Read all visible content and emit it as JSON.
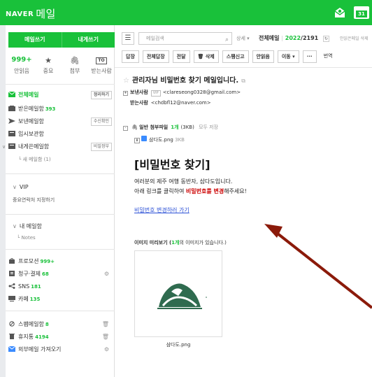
{
  "header": {
    "brand": "NAVER",
    "app_name": "메일",
    "calendar_num": "31"
  },
  "sidebar": {
    "write_mail": "메일쓰기",
    "write_to_me": "내게쓰기",
    "quick": [
      {
        "value": "999+",
        "label": "안읽음"
      },
      {
        "value": "★",
        "label": "중요"
      },
      {
        "value": "🖇",
        "label": "첨부"
      },
      {
        "value": "TO",
        "label": "받는사람"
      }
    ],
    "mailboxes": [
      {
        "label": "전체메일",
        "count": "",
        "btn": "정리하기"
      },
      {
        "label": "받은메일함",
        "count": "393",
        "btn": ""
      },
      {
        "label": "보낸메일함",
        "count": "",
        "btn": "수신확인"
      },
      {
        "label": "임시보관함",
        "count": "",
        "btn": ""
      },
      {
        "label": "내게쓴메일함",
        "count": "",
        "btn": "비밀정부"
      },
      {
        "label": "└ 새 메일함 (1)",
        "count": "",
        "btn": ""
      }
    ],
    "vip": {
      "label": "VIP",
      "sub": "중요연락처 지정하기"
    },
    "my_box": {
      "label": "내 메일함",
      "sub": "└ Notes"
    },
    "categories": [
      {
        "label": "프로모션",
        "count": "999+"
      },
      {
        "label": "청구·결제",
        "count": "68"
      },
      {
        "label": "SNS",
        "count": "181"
      },
      {
        "label": "카페",
        "count": "135"
      }
    ],
    "others": [
      {
        "label": "스팸메일함",
        "count": "8"
      },
      {
        "label": "휴지통",
        "count": "4194"
      },
      {
        "label": "외부메일 가져오기",
        "count": ""
      }
    ]
  },
  "search": {
    "menu": "☰",
    "placeholder": "메일검색",
    "detail": "상세 ▾",
    "all_mail": "전체메일",
    "current": "2022",
    "total": "2191",
    "unread_del": "안읽은메일 삭제"
  },
  "toolbar": {
    "buttons": [
      "답장",
      "전체답장",
      "전달",
      "🗑 삭제",
      "스팸신고",
      "안읽음",
      "이동 ▾",
      "···"
    ],
    "translate": "번역"
  },
  "mail": {
    "subject": "관리자님 비밀번호 찾기 메일입니다.",
    "sender_label": "보낸사람",
    "vip_badge": "VIP",
    "sender_email": "<clareseong0328@gmail.com>",
    "receiver_label": "받는사람",
    "receiver_email": "<chdbfl12@naver.com>",
    "attach_label": "일반 첨부파일",
    "attach_count": "1개",
    "attach_size": "(3KB)",
    "attach_saveall": "모두 저장",
    "file_name": "삼다도.png",
    "file_size": "3KB",
    "body_title": "[비밀번호 찾기]",
    "body_line1": "여러분의 제주 여행 동반자, 삼다도입니다.",
    "body_line2a": "아래 링크를 클릭하여 ",
    "body_line2_red": "비밀번호를 변경",
    "body_line2b": "해주세요!",
    "body_link": "비밀번호 변경하러 가기",
    "preview_a": "이미지 미리보기 (",
    "preview_count": "1개",
    "preview_b": "의 이미지가 있습니다.)",
    "preview_name": "삼다도.png"
  },
  "colors": {
    "brand": "#19c13a",
    "arrow": "#8b1a0a",
    "link": "#2a4fd6",
    "accent_red": "#cc0000"
  }
}
